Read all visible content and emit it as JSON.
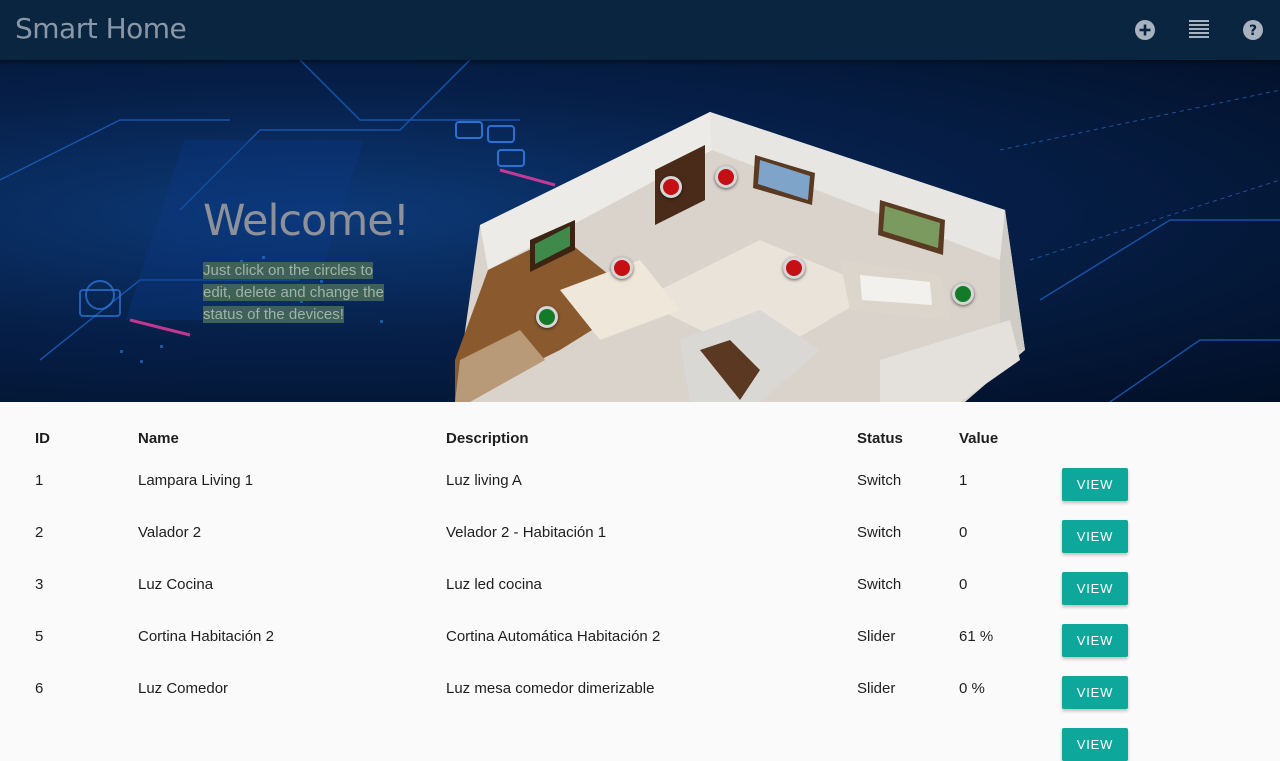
{
  "app": {
    "title": "Smart Home"
  },
  "toolbar": {
    "icons": [
      "add-circle-icon",
      "list-icon",
      "help-icon"
    ]
  },
  "hero": {
    "title": "Welcome!",
    "instructions": "Just click on the circles to edit, delete and change the status of the devices!",
    "device_dots": [
      {
        "status": "off"
      },
      {
        "status": "off"
      },
      {
        "status": "off"
      },
      {
        "status": "off"
      },
      {
        "status": "on"
      },
      {
        "status": "on"
      }
    ]
  },
  "table": {
    "headers": {
      "id": "ID",
      "name": "Name",
      "description": "Description",
      "status": "Status",
      "value": "Value"
    },
    "button_label": "VIEW",
    "rows": [
      {
        "id": "1",
        "name": "Lampara Living 1",
        "description": "Luz living A",
        "status": "Switch",
        "value": "1"
      },
      {
        "id": "2",
        "name": "Valador 2",
        "description": "Velador 2 - Habitación 1",
        "status": "Switch",
        "value": "0"
      },
      {
        "id": "3",
        "name": "Luz Cocina",
        "description": "Luz led cocina",
        "status": "Switch",
        "value": "0"
      },
      {
        "id": "5",
        "name": "Cortina Habitación 2",
        "description": "Cortina Automática Habitación 2",
        "status": "Slider",
        "value": "61 %"
      },
      {
        "id": "6",
        "name": "Luz Comedor",
        "description": "Luz mesa comedor dimerizable",
        "status": "Slider",
        "value": "0 %"
      }
    ]
  },
  "colors": {
    "topbar": "#0a2540",
    "accent": "#0ea79b",
    "device_off": "#c50f14",
    "device_on": "#137a28"
  }
}
